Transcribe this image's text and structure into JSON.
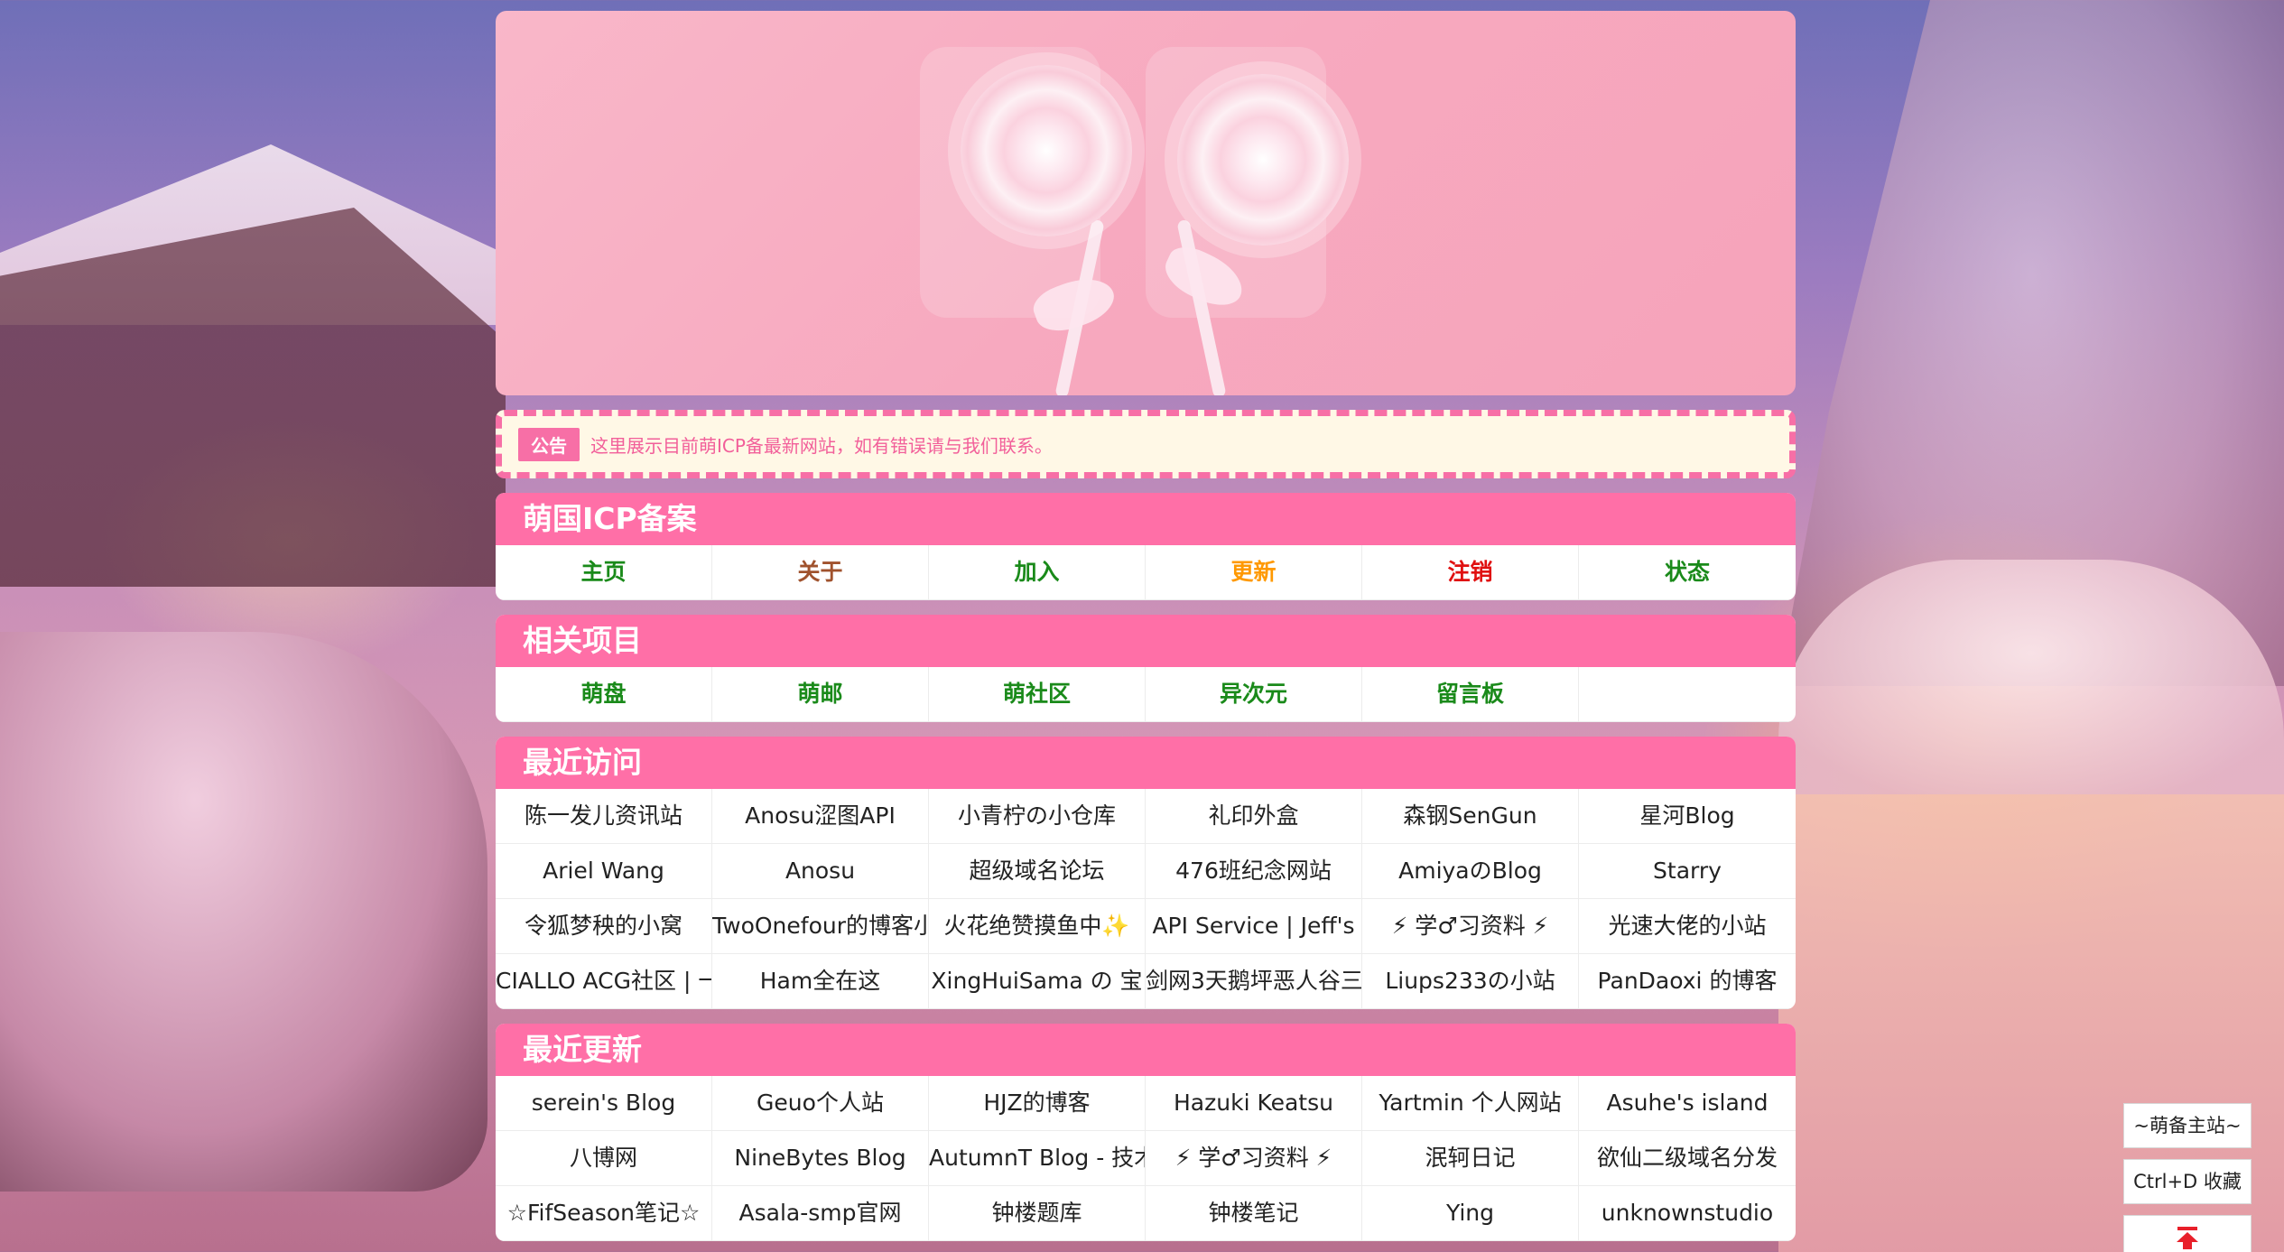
{
  "notice": {
    "tag": "公告",
    "text": "这里展示目前萌ICP备最新网站，如有错误请与我们联系。"
  },
  "colors": {
    "accent": "#ff6fa7",
    "link_green": "#1a8a1a",
    "link_brown": "#a0522d",
    "link_orange": "#ff9900",
    "link_red": "#e01010"
  },
  "nav": {
    "title": "萌国ICP备案",
    "items": [
      {
        "label": "主页",
        "color": "#1a8a1a"
      },
      {
        "label": "关于",
        "color": "#a0522d"
      },
      {
        "label": "加入",
        "color": "#1a8a1a"
      },
      {
        "label": "更新",
        "color": "#ff9900"
      },
      {
        "label": "注销",
        "color": "#e01010"
      },
      {
        "label": "状态",
        "color": "#1a8a1a"
      }
    ]
  },
  "related": {
    "title": "相关项目",
    "items": [
      {
        "label": "萌盘",
        "color": "#1a8a1a"
      },
      {
        "label": "萌邮",
        "color": "#1a8a1a"
      },
      {
        "label": "萌社区",
        "color": "#1a8a1a"
      },
      {
        "label": "异次元",
        "color": "#1a8a1a"
      },
      {
        "label": "留言板",
        "color": "#1a8a1a"
      },
      {
        "label": "",
        "color": "#1a8a1a"
      }
    ]
  },
  "recent_visits": {
    "title": "最近访问",
    "items": [
      "陈一发儿资讯站",
      "Anosu涩图API",
      "小青柠の小仓库",
      "礼印外盒",
      "森钢SenGun",
      "星河Blog",
      "Ariel Wang",
      "Anosu",
      "超级域名论坛",
      "476班纪念网站",
      "AmiyaのBlog",
      "Starry",
      "令狐梦秧的小窝",
      "TwoOnefour的博客小",
      "火花绝赞摸鱼中✨",
      "API Service | Jeff's",
      "⚡ 学♂习资料 ⚡",
      "光速大佬的小站",
      "CIALLO ACG社区 | 一",
      "Ham全在这",
      "XingHuiSama の 宝",
      "剑网3天鹅坪恶人谷三",
      "Liups233の小站",
      "PanDaoxi 的博客"
    ]
  },
  "recent_updates": {
    "title": "最近更新",
    "items": [
      "serein's Blog",
      "Geuo个人站",
      "HJZ的博客",
      "Hazuki Keatsu",
      "Yartmin 个人网站",
      "Asuhe's island",
      "八博网",
      "NineBytes Blog",
      "AutumnT Blog - 技术",
      "⚡ 学♂习资料 ⚡",
      "泯轲日记",
      "欲仙二级域名分发",
      "☆FifSeason笔记☆",
      "Asala-smp官网",
      "钟楼题库",
      "钟楼笔记",
      "Ying",
      "unknownstudio"
    ]
  },
  "side": {
    "home_label": "~萌备主站~",
    "bookmark_label": "Ctrl+D 收藏",
    "top_icon": "arrow-up-to-top-icon"
  }
}
